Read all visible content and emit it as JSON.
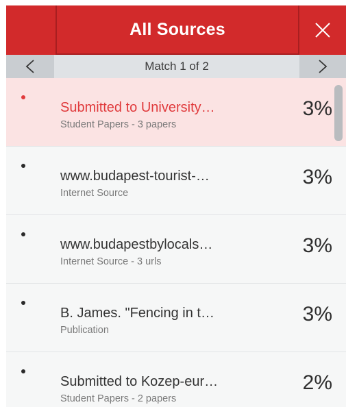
{
  "header": {
    "title": "All Sources",
    "close_icon": "close-icon",
    "color": "#d22a2b"
  },
  "nav": {
    "prev_icon": "chevron-left-icon",
    "next_icon": "chevron-right-icon",
    "match_text": "Match 1 of 2"
  },
  "sources": [
    {
      "name": "Submitted to University…",
      "type": "Student Papers - 3 papers",
      "percent": "3%",
      "active": true
    },
    {
      "name": "www.budapest-tourist-…",
      "type": "Internet Source",
      "percent": "3%",
      "active": false
    },
    {
      "name": "www.budapestbylocals…",
      "type": "Internet Source - 3 urls",
      "percent": "3%",
      "active": false
    },
    {
      "name": "B. James. \"Fencing in t…",
      "type": "Publication",
      "percent": "3%",
      "active": false
    },
    {
      "name": "Submitted to Kozep-eur…",
      "type": "Student Papers - 2 papers",
      "percent": "2%",
      "active": false
    }
  ],
  "colors": {
    "active_row": "#fbe3e3",
    "active_text": "#e03a3c"
  }
}
